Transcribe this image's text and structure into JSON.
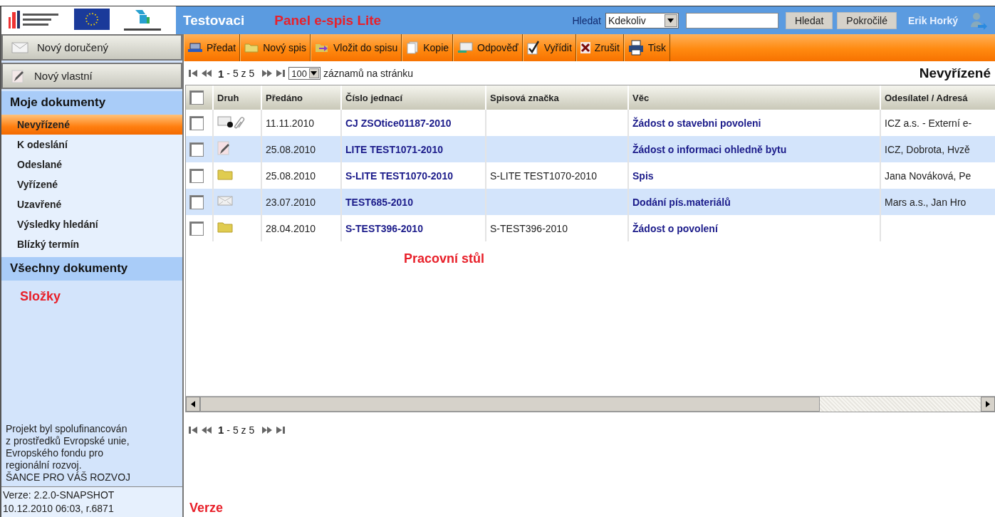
{
  "header": {
    "title": "Testovaci",
    "annotation": "Panel e-spis Lite",
    "search_label": "Hledat",
    "search_scope": "Kdekoliv",
    "search_button": "Hledat",
    "advanced_button": "Pokročilé",
    "user": "Erik Horký"
  },
  "sidebar": {
    "new_buttons": [
      {
        "kind": "mail",
        "label": "Nový doručený"
      },
      {
        "kind": "pencil",
        "label": "Nový vlastní"
      }
    ],
    "section_title": "Moje dokumenty",
    "items": [
      {
        "label": "Nevyřízené",
        "selected": true
      },
      {
        "label": "K odeslání",
        "selected": false
      },
      {
        "label": "Odeslané",
        "selected": false
      },
      {
        "label": "Vyřízené",
        "selected": false
      },
      {
        "label": "Uzavřené",
        "selected": false
      },
      {
        "label": "Výsledky hledání",
        "selected": false
      },
      {
        "label": "Blízký termín",
        "selected": false
      }
    ],
    "section2_title": "Všechny dokumenty",
    "annotation": "Složky",
    "footer_lines": [
      "Projekt byl spolufinancován",
      "z prostředků Evropské unie,",
      "Evropského fondu pro",
      "regionální rozvoj.",
      "ŠANCE PRO VÁŠ ROZVOJ"
    ],
    "version_lines": [
      "Verze: 2.2.0-SNAPSHOT",
      "10.12.2010 06:03, r.6871"
    ],
    "version_annotation": "Verze"
  },
  "toolbar": [
    {
      "kind": "handover",
      "label": "Předat"
    },
    {
      "kind": "folder",
      "label": "Nový spis"
    },
    {
      "kind": "insert",
      "label": "Vložit do spisu"
    },
    {
      "kind": "copy",
      "label": "Kopie"
    },
    {
      "kind": "reply",
      "label": "Odpověď"
    },
    {
      "kind": "check",
      "label": "Vyřídit"
    },
    {
      "kind": "cancel",
      "label": "Zrušit"
    },
    {
      "kind": "print",
      "label": "Tisk"
    }
  ],
  "pager": {
    "current": "1",
    "range": "- 5 z 5",
    "page_size": "100",
    "page_size_label": "záznamů na stránku"
  },
  "view_title": "Nevyřízené",
  "table": {
    "select_all_checked": false,
    "columns": [
      "Druh",
      "Předáno",
      "Číslo jednací",
      "Spisová značka",
      "Věc",
      "Odesílatel / Adresá"
    ],
    "rows": [
      {
        "checked": false,
        "kind": "email",
        "date": "11.11.2010",
        "number": "CJ ZSOtice01187-2010",
        "file_mark": "",
        "subject": "Žádost o stavebni povoleni",
        "sender": "ICZ a.s. - Externí e-"
      },
      {
        "checked": false,
        "kind": "own",
        "date": "25.08.2010",
        "number": "LITE TEST1071-2010",
        "file_mark": "",
        "subject": "Žádost o informaci ohledně bytu",
        "sender": "ICZ, Dobrota, Hvzě"
      },
      {
        "checked": false,
        "kind": "folder",
        "date": "25.08.2010",
        "number": "S-LITE TEST1070-2010",
        "file_mark": "S-LITE TEST1070-2010",
        "subject": "Spis",
        "sender": "Jana Nováková, Pe"
      },
      {
        "checked": false,
        "kind": "mail",
        "date": "23.07.2010",
        "number": "TEST685-2010",
        "file_mark": "",
        "subject": "Dodání pís.materiálů",
        "sender": "Mars a.s., Jan Hro"
      },
      {
        "checked": false,
        "kind": "folder",
        "date": "28.04.2010",
        "number": "S-TEST396-2010",
        "file_mark": "S-TEST396-2010",
        "subject": "Žádost o povolení",
        "sender": ""
      }
    ]
  },
  "workspace_annotation": "Pracovní stůl",
  "bottom_pager": {
    "current": "1",
    "range": "- 5 z 5"
  }
}
